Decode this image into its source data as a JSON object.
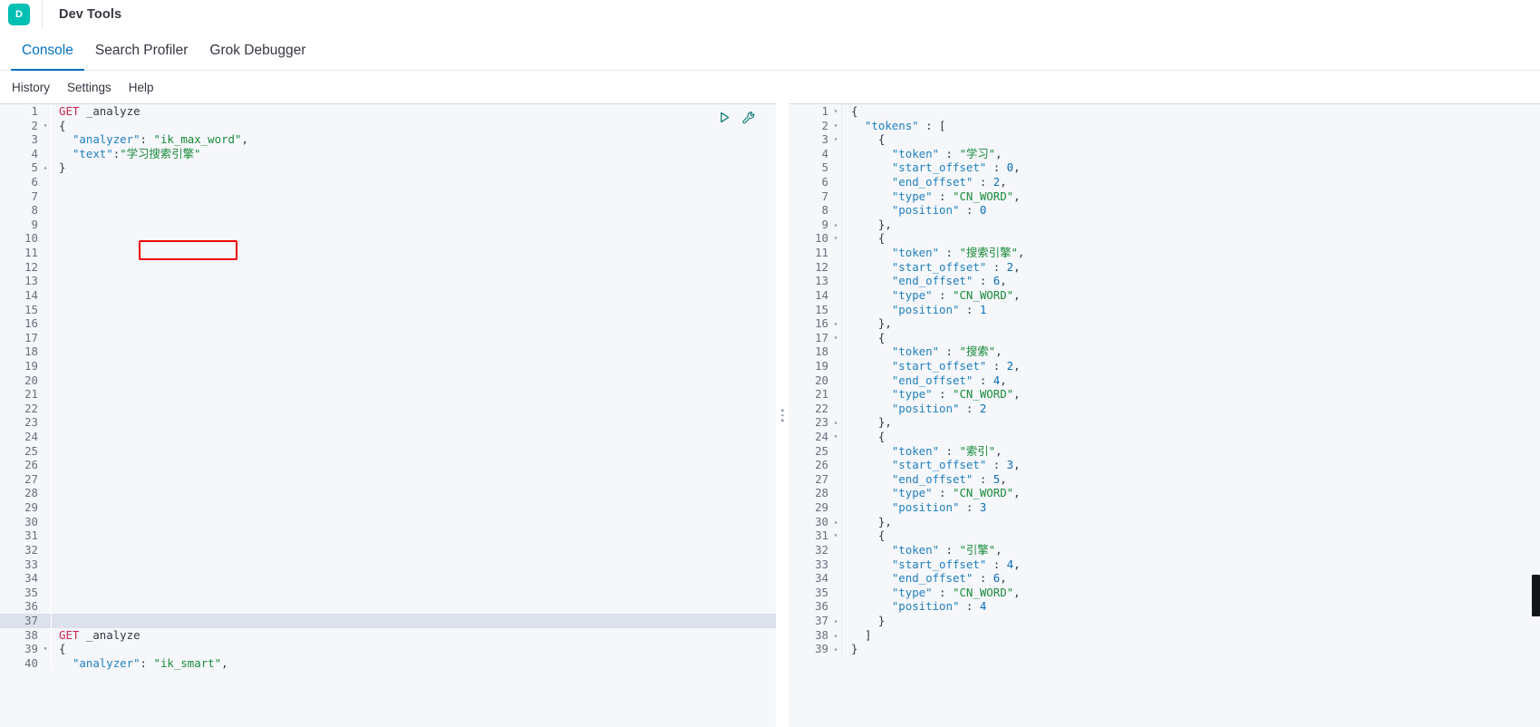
{
  "header": {
    "logo_letter": "D",
    "title": "Dev Tools"
  },
  "tabs": [
    {
      "label": "Console",
      "active": true
    },
    {
      "label": "Search Profiler",
      "active": false
    },
    {
      "label": "Grok Debugger",
      "active": false
    }
  ],
  "submenu": [
    {
      "label": "History"
    },
    {
      "label": "Settings"
    },
    {
      "label": "Help"
    }
  ],
  "icons": {
    "play": "play-triangle-icon",
    "wrench": "wrench-icon",
    "drag_handle": "vertical-drag-handle-icon"
  },
  "colors": {
    "accent": "#0071c2",
    "brand": "#00bfb3",
    "annotation": "#ee0000",
    "string": "#1a8a3a",
    "key": "#1f7fbf",
    "method": "#c7254e"
  },
  "annotation": {
    "label": "ik_max_word",
    "note": "red-highlight-rectangle"
  },
  "request_editor": {
    "name": "console-request-editor",
    "active_line": 37,
    "total_visible_lines": 40,
    "lines": [
      {
        "n": 1,
        "fold": "",
        "text": "GET _analyze"
      },
      {
        "n": 2,
        "fold": "▾",
        "text": "{"
      },
      {
        "n": 3,
        "fold": "",
        "text": "  \"analyzer\": \"ik_max_word\","
      },
      {
        "n": 4,
        "fold": "",
        "text": "  \"text\":\"学习搜索引擎\""
      },
      {
        "n": 5,
        "fold": "▴",
        "text": "}"
      },
      {
        "n": 6,
        "fold": "",
        "text": ""
      },
      {
        "n": 7,
        "fold": "",
        "text": ""
      },
      {
        "n": 8,
        "fold": "",
        "text": ""
      },
      {
        "n": 9,
        "fold": "",
        "text": ""
      },
      {
        "n": 10,
        "fold": "",
        "text": ""
      },
      {
        "n": 11,
        "fold": "",
        "text": ""
      },
      {
        "n": 12,
        "fold": "",
        "text": ""
      },
      {
        "n": 13,
        "fold": "",
        "text": ""
      },
      {
        "n": 14,
        "fold": "",
        "text": ""
      },
      {
        "n": 15,
        "fold": "",
        "text": ""
      },
      {
        "n": 16,
        "fold": "",
        "text": ""
      },
      {
        "n": 17,
        "fold": "",
        "text": ""
      },
      {
        "n": 18,
        "fold": "",
        "text": ""
      },
      {
        "n": 19,
        "fold": "",
        "text": ""
      },
      {
        "n": 20,
        "fold": "",
        "text": ""
      },
      {
        "n": 21,
        "fold": "",
        "text": ""
      },
      {
        "n": 22,
        "fold": "",
        "text": ""
      },
      {
        "n": 23,
        "fold": "",
        "text": ""
      },
      {
        "n": 24,
        "fold": "",
        "text": ""
      },
      {
        "n": 25,
        "fold": "",
        "text": ""
      },
      {
        "n": 26,
        "fold": "",
        "text": ""
      },
      {
        "n": 27,
        "fold": "",
        "text": ""
      },
      {
        "n": 28,
        "fold": "",
        "text": ""
      },
      {
        "n": 29,
        "fold": "",
        "text": ""
      },
      {
        "n": 30,
        "fold": "",
        "text": ""
      },
      {
        "n": 31,
        "fold": "",
        "text": ""
      },
      {
        "n": 32,
        "fold": "",
        "text": ""
      },
      {
        "n": 33,
        "fold": "",
        "text": ""
      },
      {
        "n": 34,
        "fold": "",
        "text": ""
      },
      {
        "n": 35,
        "fold": "",
        "text": ""
      },
      {
        "n": 36,
        "fold": "",
        "text": ""
      },
      {
        "n": 37,
        "fold": "",
        "text": ""
      },
      {
        "n": 38,
        "fold": "",
        "text": "GET _analyze"
      },
      {
        "n": 39,
        "fold": "▾",
        "text": "{"
      },
      {
        "n": 40,
        "fold": "",
        "text": "  \"analyzer\": \"ik_smart\","
      }
    ]
  },
  "response_editor": {
    "name": "console-response-viewer",
    "lines": [
      {
        "n": 1,
        "fold": "▾",
        "text": "{"
      },
      {
        "n": 2,
        "fold": "▾",
        "text": "  \"tokens\" : ["
      },
      {
        "n": 3,
        "fold": "▾",
        "text": "    {"
      },
      {
        "n": 4,
        "fold": "",
        "text": "      \"token\" : \"学习\","
      },
      {
        "n": 5,
        "fold": "",
        "text": "      \"start_offset\" : 0,"
      },
      {
        "n": 6,
        "fold": "",
        "text": "      \"end_offset\" : 2,"
      },
      {
        "n": 7,
        "fold": "",
        "text": "      \"type\" : \"CN_WORD\","
      },
      {
        "n": 8,
        "fold": "",
        "text": "      \"position\" : 0"
      },
      {
        "n": 9,
        "fold": "▴",
        "text": "    },"
      },
      {
        "n": 10,
        "fold": "▾",
        "text": "    {"
      },
      {
        "n": 11,
        "fold": "",
        "text": "      \"token\" : \"搜索引擎\","
      },
      {
        "n": 12,
        "fold": "",
        "text": "      \"start_offset\" : 2,"
      },
      {
        "n": 13,
        "fold": "",
        "text": "      \"end_offset\" : 6,"
      },
      {
        "n": 14,
        "fold": "",
        "text": "      \"type\" : \"CN_WORD\","
      },
      {
        "n": 15,
        "fold": "",
        "text": "      \"position\" : 1"
      },
      {
        "n": 16,
        "fold": "▴",
        "text": "    },"
      },
      {
        "n": 17,
        "fold": "▾",
        "text": "    {"
      },
      {
        "n": 18,
        "fold": "",
        "text": "      \"token\" : \"搜索\","
      },
      {
        "n": 19,
        "fold": "",
        "text": "      \"start_offset\" : 2,"
      },
      {
        "n": 20,
        "fold": "",
        "text": "      \"end_offset\" : 4,"
      },
      {
        "n": 21,
        "fold": "",
        "text": "      \"type\" : \"CN_WORD\","
      },
      {
        "n": 22,
        "fold": "",
        "text": "      \"position\" : 2"
      },
      {
        "n": 23,
        "fold": "▴",
        "text": "    },"
      },
      {
        "n": 24,
        "fold": "▾",
        "text": "    {"
      },
      {
        "n": 25,
        "fold": "",
        "text": "      \"token\" : \"索引\","
      },
      {
        "n": 26,
        "fold": "",
        "text": "      \"start_offset\" : 3,"
      },
      {
        "n": 27,
        "fold": "",
        "text": "      \"end_offset\" : 5,"
      },
      {
        "n": 28,
        "fold": "",
        "text": "      \"type\" : \"CN_WORD\","
      },
      {
        "n": 29,
        "fold": "",
        "text": "      \"position\" : 3"
      },
      {
        "n": 30,
        "fold": "▴",
        "text": "    },"
      },
      {
        "n": 31,
        "fold": "▾",
        "text": "    {"
      },
      {
        "n": 32,
        "fold": "",
        "text": "      \"token\" : \"引擎\","
      },
      {
        "n": 33,
        "fold": "",
        "text": "      \"start_offset\" : 4,"
      },
      {
        "n": 34,
        "fold": "",
        "text": "      \"end_offset\" : 6,"
      },
      {
        "n": 35,
        "fold": "",
        "text": "      \"type\" : \"CN_WORD\","
      },
      {
        "n": 36,
        "fold": "",
        "text": "      \"position\" : 4"
      },
      {
        "n": 37,
        "fold": "▴",
        "text": "    }"
      },
      {
        "n": 38,
        "fold": "▴",
        "text": "  ]"
      },
      {
        "n": 39,
        "fold": "▴",
        "text": "}"
      }
    ]
  }
}
